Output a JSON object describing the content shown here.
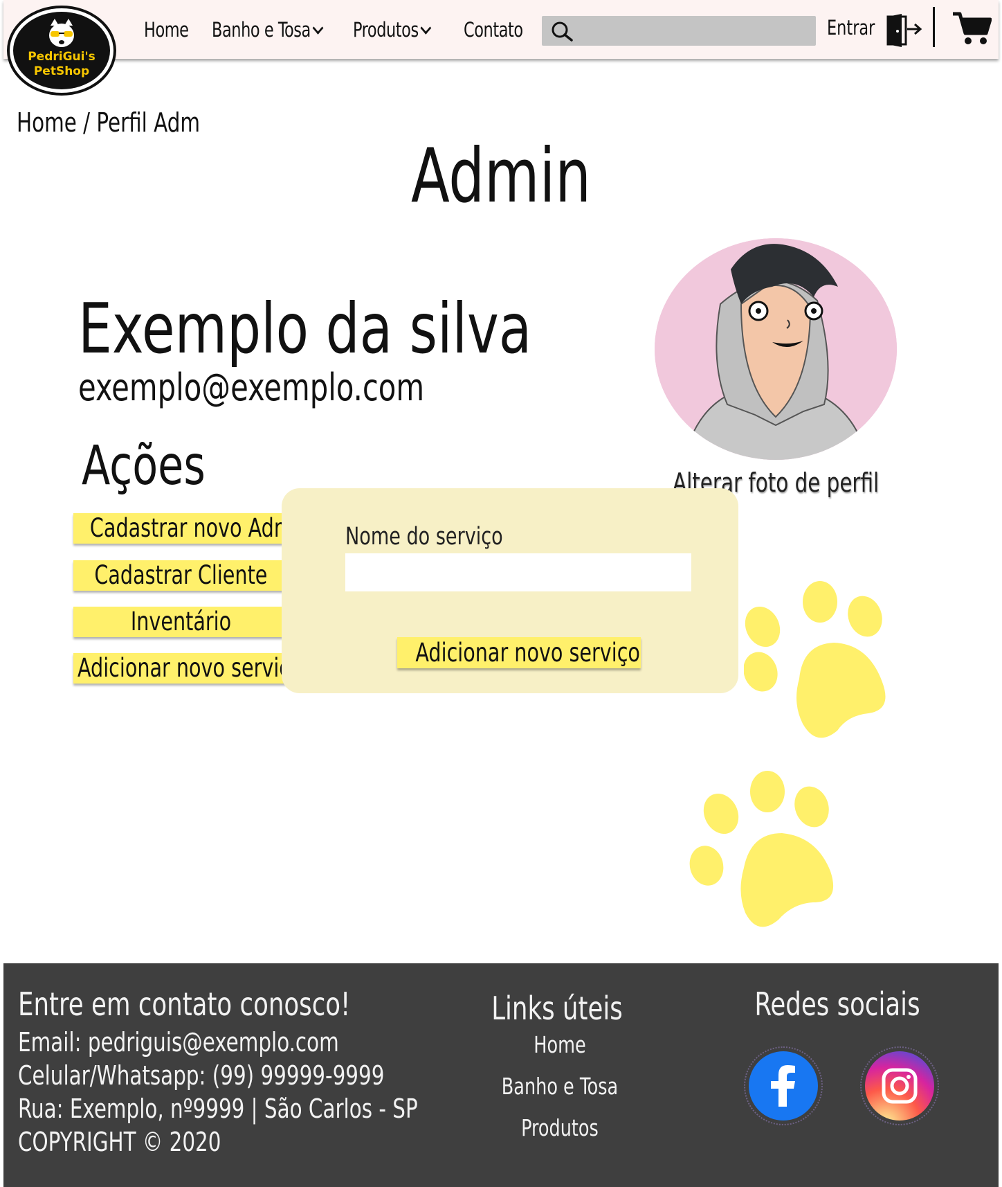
{
  "nav": {
    "logo_line1": "PedriGui's",
    "logo_line2": "PetShop",
    "links": [
      "Home",
      "Banho e Tosa",
      "Produtos",
      "Contato"
    ],
    "search_placeholder": "",
    "login_label": "Entrar"
  },
  "breadcrumb": "Home / Perfil Adm",
  "page_title": "Admin",
  "profile": {
    "name": "Exemplo da silva",
    "email": "exemplo@exemplo.com",
    "change_photo": "Alterar foto de perfil"
  },
  "actions": {
    "title": "Ações",
    "buttons": [
      "Cadastrar novo Adm",
      "Cadastrar Cliente",
      "Inventário",
      "Adicionar novo serviço"
    ]
  },
  "modal": {
    "label": "Nome do serviço",
    "input_value": "",
    "submit_label": "Adicionar novo serviço"
  },
  "footer": {
    "contact_title": "Entre em contato conosco!",
    "email": "Email: pedriguis@exemplo.com",
    "phone": "Celular/Whatsapp: (99) 99999-9999",
    "address": "Rua: Exemplo, nº9999 | São Carlos - SP",
    "copyright": "COPYRIGHT © 2020",
    "links_title": "Links úteis",
    "links": [
      "Home",
      "Banho e Tosa",
      "Produtos"
    ],
    "social_title": "Redes sociais"
  },
  "colors": {
    "nav_bg": "#fdf3f2",
    "button_yellow": "#fff06b",
    "modal_bg": "#f7f0c6",
    "paw_yellow": "#fff06b",
    "footer_bg": "#3f3f3f"
  },
  "icons": [
    "search-icon",
    "door-exit-icon",
    "cart-icon",
    "chevron-down-icon",
    "paw-icon",
    "facebook-icon",
    "instagram-icon"
  ]
}
